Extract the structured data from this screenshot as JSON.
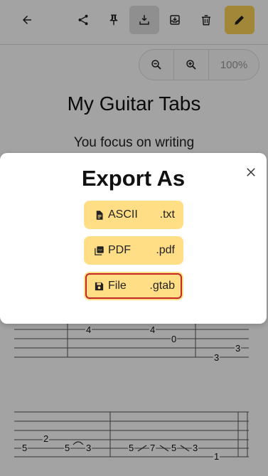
{
  "toolbar": {
    "icons": [
      "back-arrow-icon",
      "share-icon",
      "pin-icon",
      "download-icon",
      "archive-icon",
      "trash-icon",
      "pencil-icon"
    ],
    "accent_color": "#ffd45a"
  },
  "zoom": {
    "value": "100%"
  },
  "document": {
    "title": "My Guitar Tabs",
    "subtitle": "You focus on writing"
  },
  "tab": {
    "staff1_numbers": [
      "4",
      "4",
      "0",
      "3",
      "3"
    ],
    "staff2_numbers": [
      "5",
      "2",
      "5",
      "3",
      "5",
      "7",
      "5",
      "3",
      "1"
    ]
  },
  "modal": {
    "title": "Export As",
    "options": [
      {
        "label": "ASCII",
        "ext": ".txt",
        "icon": "file-text-icon"
      },
      {
        "label": "PDF",
        "ext": ".pdf",
        "icon": "pdf-icon"
      },
      {
        "label": "File",
        "ext": ".gtab",
        "icon": "save-icon"
      }
    ],
    "button_color": "#ffde85"
  }
}
